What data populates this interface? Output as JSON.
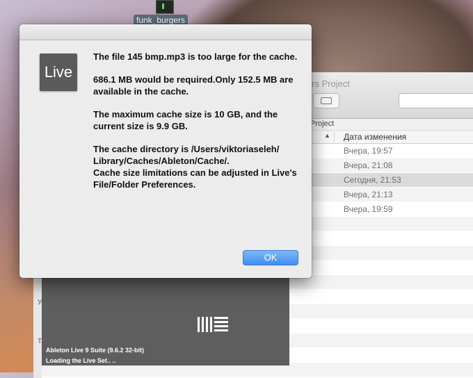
{
  "desktop": {
    "icon_label": "funk_burgers"
  },
  "finder": {
    "title": "rs Project",
    "path_label": "Project",
    "column_header": "Дата изменения",
    "rows": [
      "Вчера, 19:57",
      "Вчера, 21:08",
      "Сегодня, 21:53",
      "Вчера, 21:13",
      "Вчера, 19:59"
    ],
    "sidebar_fragments": [
      "У",
      "Т"
    ]
  },
  "splash": {
    "line1": "Ableton Live 9 Suite (9.6.2 32-bit)",
    "line2": "Loading the Live Set.. .."
  },
  "dialog": {
    "icon_text": "Live",
    "p1": "The file 145 bmp.mp3 is too large for the cache.",
    "p2": "686.1 MB would be required.Only 152.5 MB are available in the cache.",
    "p3": "The maximum cache size is 10 GB, and the current size is 9.9 GB.",
    "p4a": "The cache directory is /Users/viktoriaseleh/ Library/Caches/Ableton/Cache/.",
    "p4b": "Cache size limitations can be adjusted in Live's File/Folder Preferences.",
    "ok_label": "OK"
  }
}
